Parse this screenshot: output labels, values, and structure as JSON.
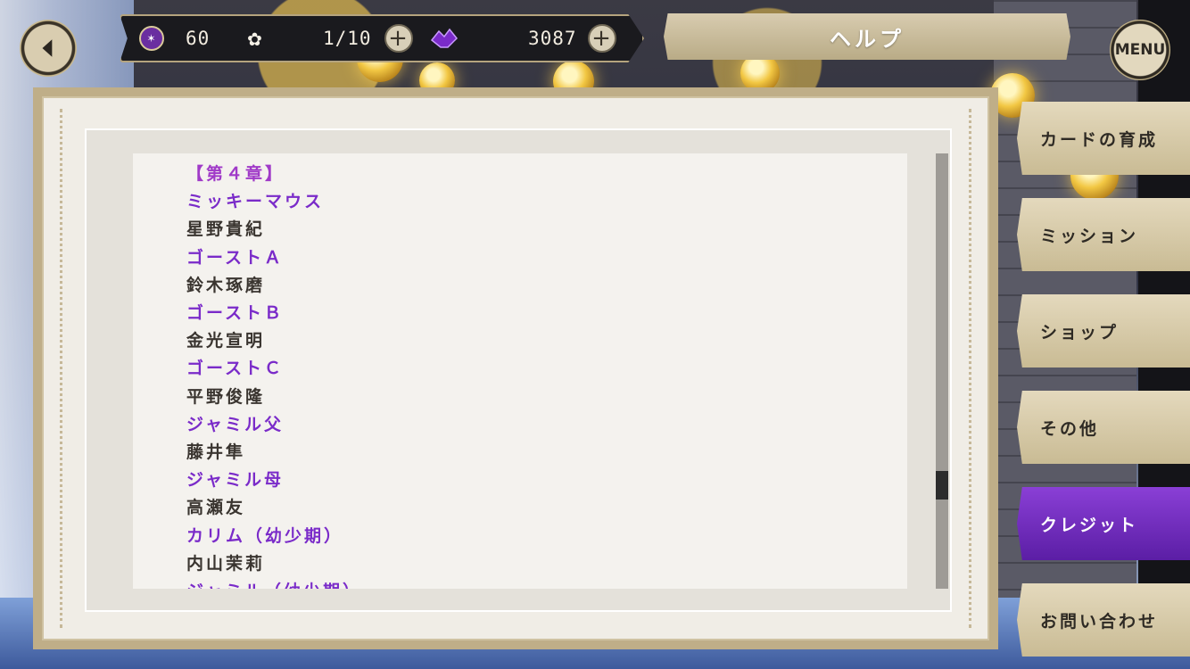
{
  "header": {
    "title": "ヘルプ",
    "menu_label": "MENU",
    "resources": {
      "coins": "60",
      "stamina": "1/10",
      "gems": "3087"
    },
    "plus_glyph": "+"
  },
  "side_tabs": [
    {
      "label": "カードの育成",
      "active": false
    },
    {
      "label": "ミッション",
      "active": false
    },
    {
      "label": "ショップ",
      "active": false
    },
    {
      "label": "その他",
      "active": false
    },
    {
      "label": "クレジット",
      "active": true
    },
    {
      "label": "お問い合わせ",
      "active": false
    }
  ],
  "credits": [
    {
      "text": "【第４章】",
      "kind": "head"
    },
    {
      "text": "ミッキーマウス",
      "kind": "role"
    },
    {
      "text": "星野貴紀",
      "kind": "actor"
    },
    {
      "text": "ゴーストＡ",
      "kind": "role"
    },
    {
      "text": "鈴木琢磨",
      "kind": "actor"
    },
    {
      "text": "ゴーストＢ",
      "kind": "role"
    },
    {
      "text": "金光宣明",
      "kind": "actor"
    },
    {
      "text": "ゴーストＣ",
      "kind": "role"
    },
    {
      "text": "平野俊隆",
      "kind": "actor"
    },
    {
      "text": "ジャミル父",
      "kind": "role"
    },
    {
      "text": "藤井隼",
      "kind": "actor"
    },
    {
      "text": "ジャミル母",
      "kind": "role"
    },
    {
      "text": "高瀬友",
      "kind": "actor"
    },
    {
      "text": "カリム（幼少期）",
      "kind": "role"
    },
    {
      "text": "内山茉莉",
      "kind": "actor"
    },
    {
      "text": "ジャミル（幼少期）",
      "kind": "role"
    }
  ],
  "colors": {
    "role": "#7a2bc9",
    "actor": "#3a3530",
    "active_tab": "#6b2ab8"
  },
  "scroll_position": 0.78
}
